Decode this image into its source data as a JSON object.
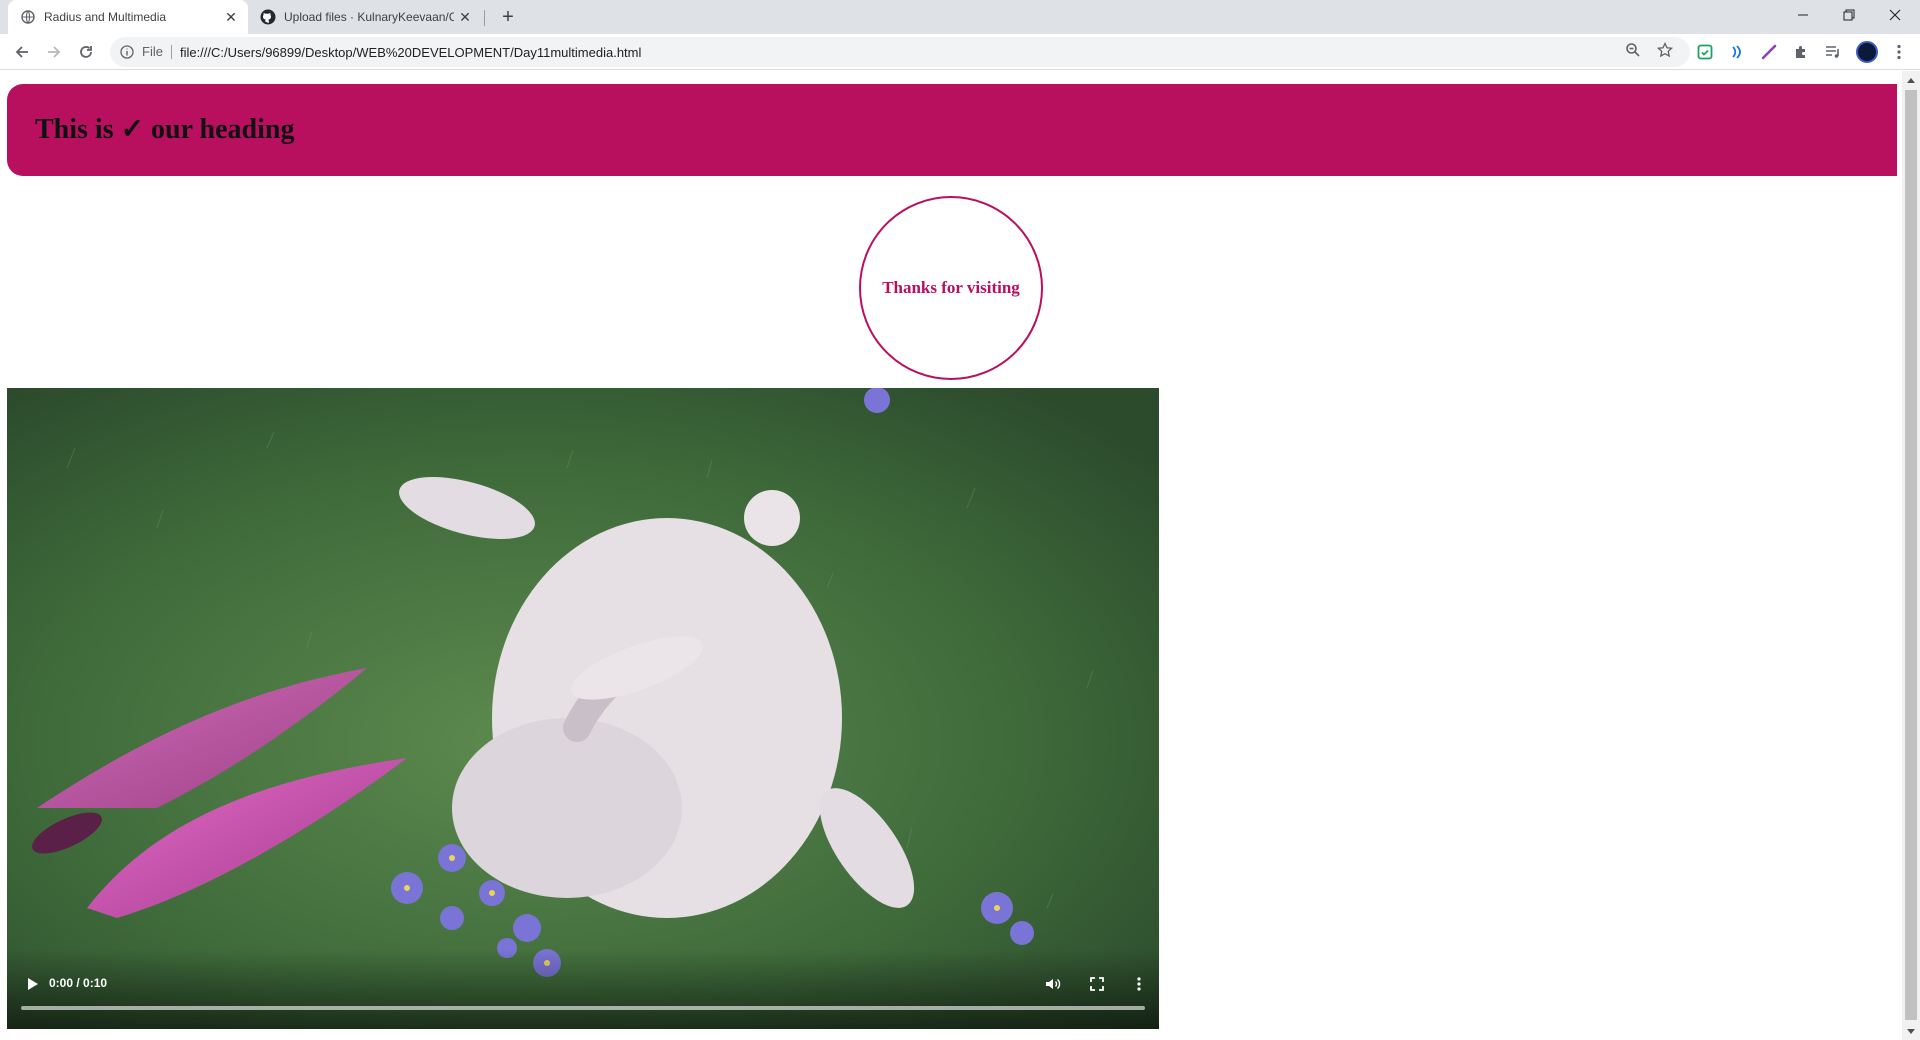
{
  "browser": {
    "tabs": [
      {
        "title": "Radius and Multimedia",
        "active": true,
        "favicon": "globe-icon"
      },
      {
        "title": "Upload files · KulnaryKeevaan/CC",
        "active": false,
        "favicon": "github-icon"
      }
    ],
    "new_tab_label": "+",
    "address": {
      "scheme_label": "File",
      "url": "file:///C:/Users/96899/Desktop/WEB%20DEVELOPMENT/Day11multimedia.html"
    },
    "window_controls": [
      "minimize",
      "restore",
      "close"
    ]
  },
  "page": {
    "heading": "This is ✓ our heading",
    "circle_text": "Thanks for visiting",
    "video": {
      "time": "0:00 / 0:10",
      "progress": 0.0
    }
  },
  "colors": {
    "accent": "#b80f5f",
    "tabstrip": "#dee1e6",
    "omnibox": "#f1f3f4"
  }
}
